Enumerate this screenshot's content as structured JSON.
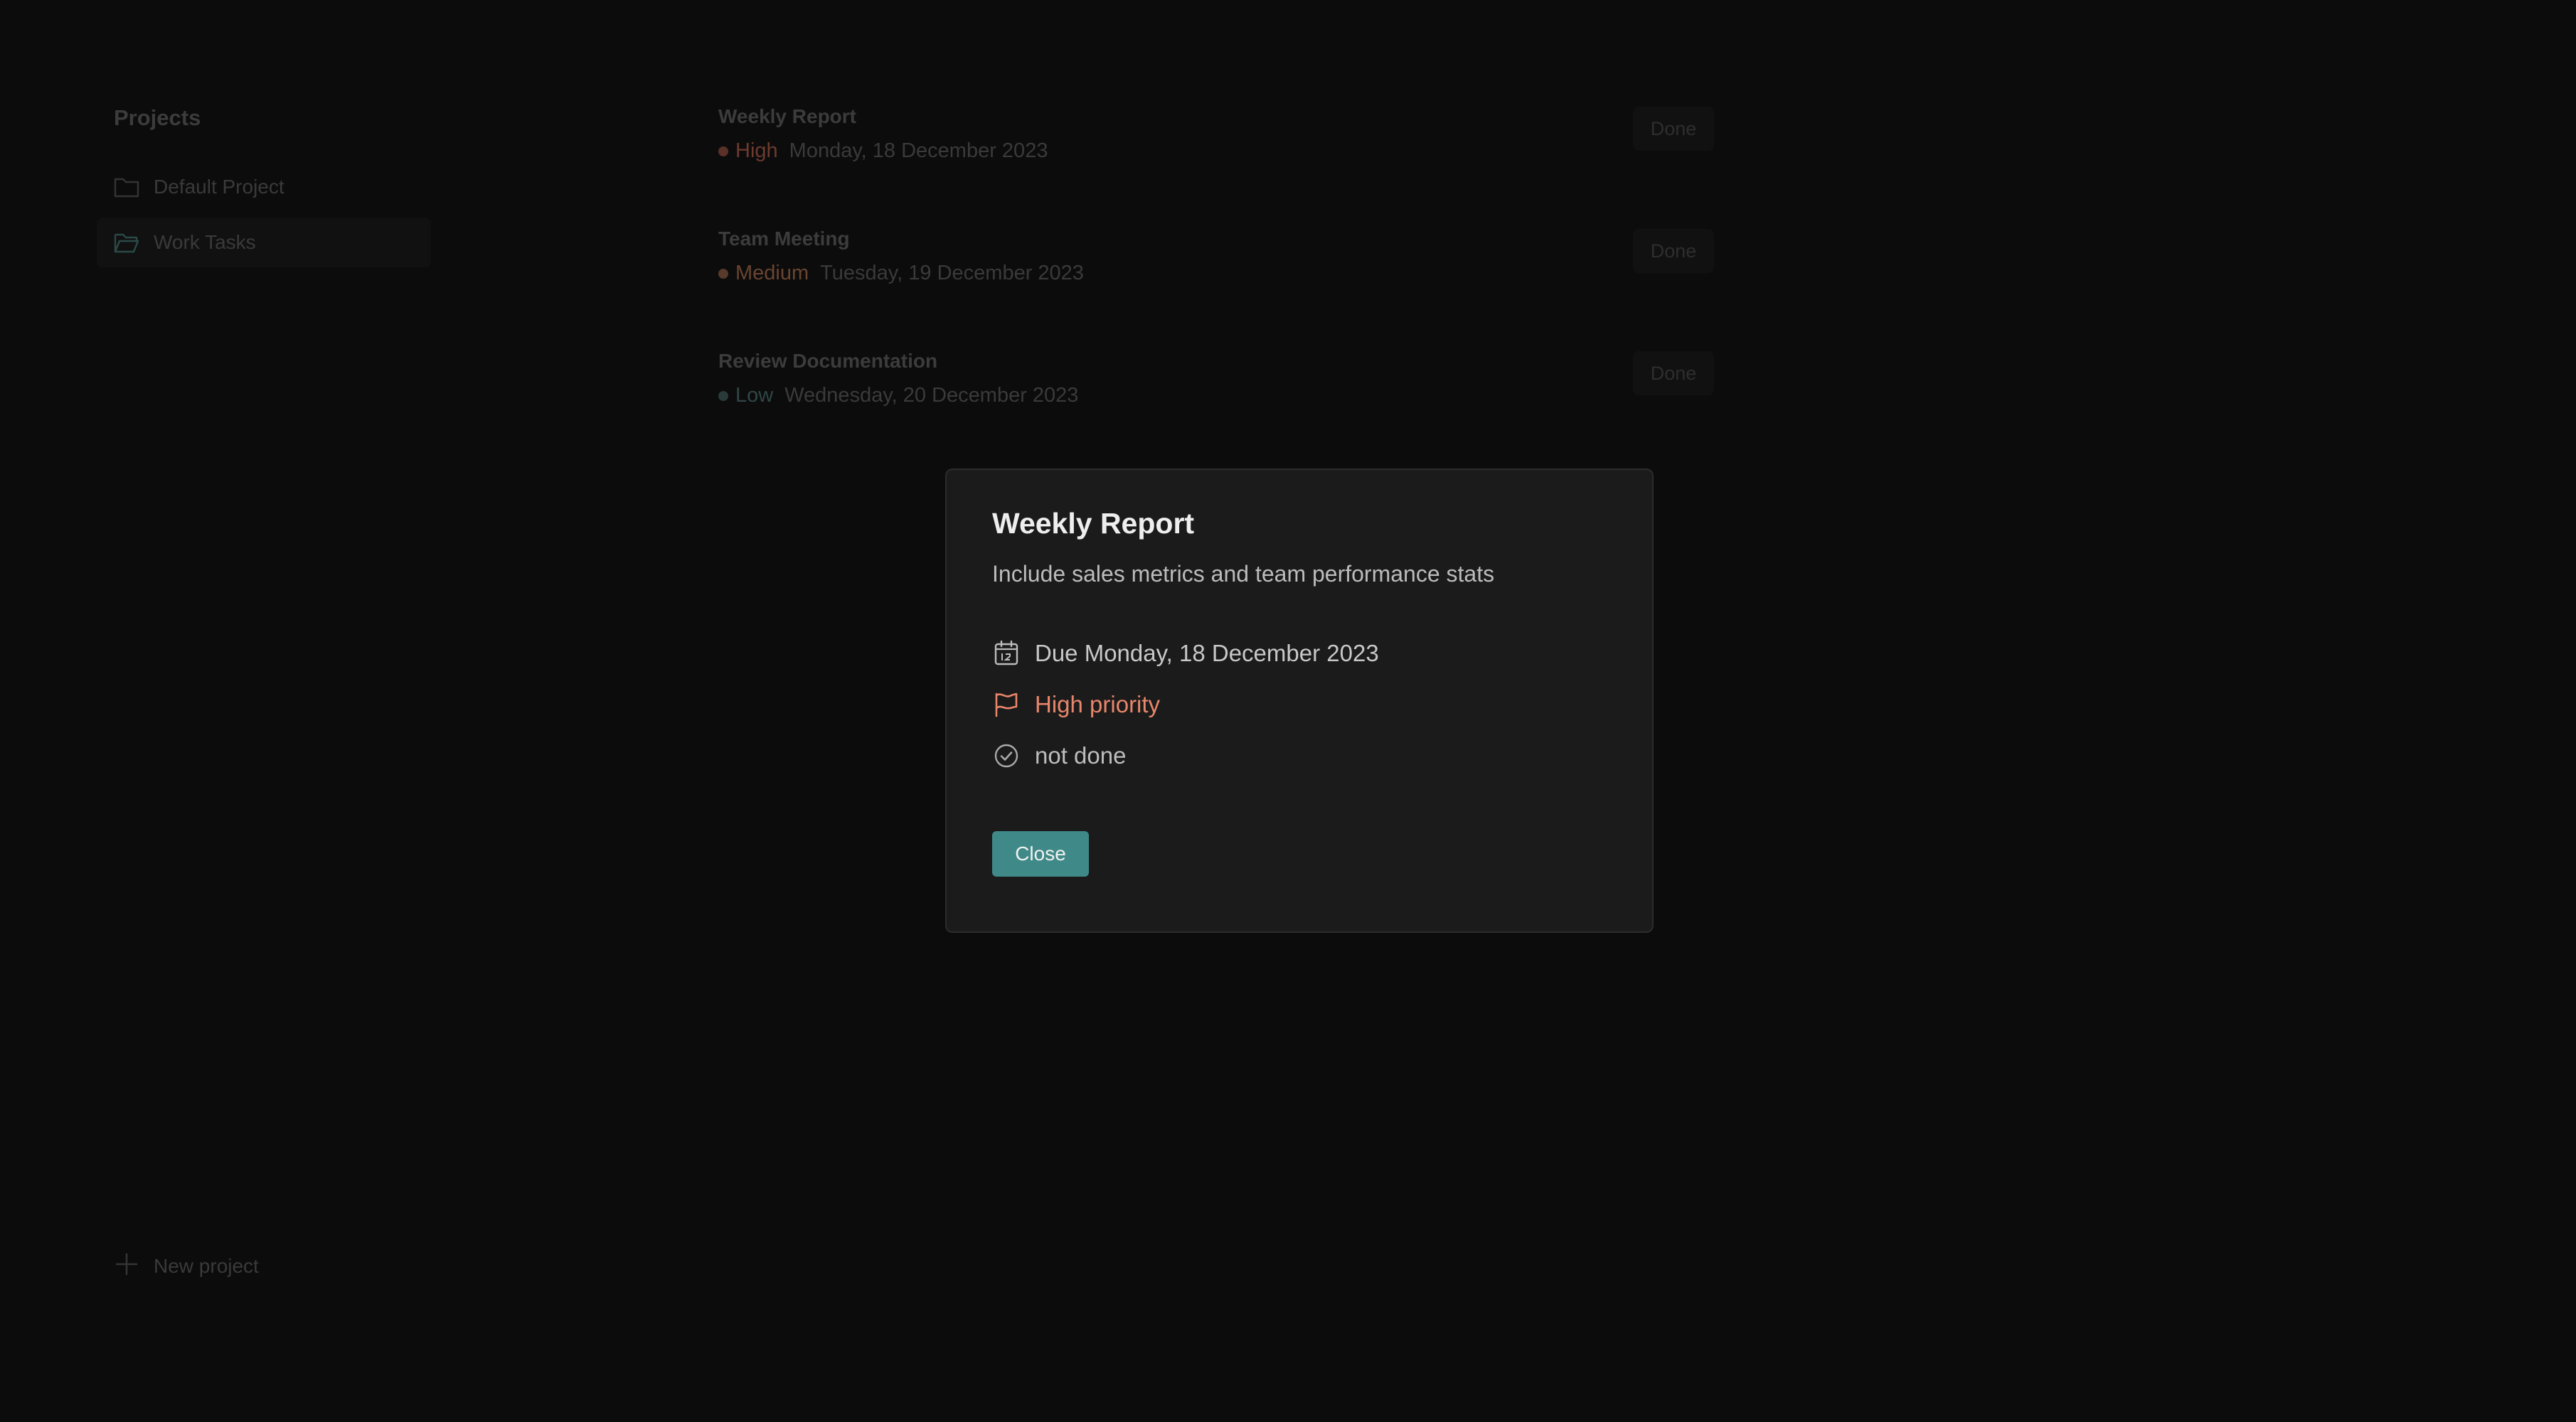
{
  "sidebar": {
    "title": "Projects",
    "items": [
      {
        "label": "Default Project",
        "icon": "folder-icon",
        "active": false
      },
      {
        "label": "Work Tasks",
        "icon": "folder-open-icon",
        "active": true
      }
    ],
    "new_project_label": "New project"
  },
  "tasks": [
    {
      "title": "Weekly Report",
      "priority": "High",
      "priority_color": "#6e3a2f",
      "date": "Monday, 18 December 2023",
      "done_label": "Done"
    },
    {
      "title": "Team Meeting",
      "priority": "Medium",
      "priority_color": "#6a4431",
      "date": "Tuesday, 19 December 2023",
      "done_label": "Done"
    },
    {
      "title": "Review Documentation",
      "priority": "Low",
      "priority_color": "#2f4746",
      "date": "Wednesday, 20 December 2023",
      "done_label": "Done"
    }
  ],
  "modal": {
    "title": "Weekly Report",
    "description": "Include sales metrics and team performance stats",
    "due": "Due Monday, 18 December 2023",
    "priority": "High priority",
    "status": "not done",
    "close_label": "Close"
  },
  "colors": {
    "accent": "#3f8a88",
    "high_priority": "#e8866b",
    "background": "#0c0c0c",
    "modal_background": "#1b1b1b"
  }
}
